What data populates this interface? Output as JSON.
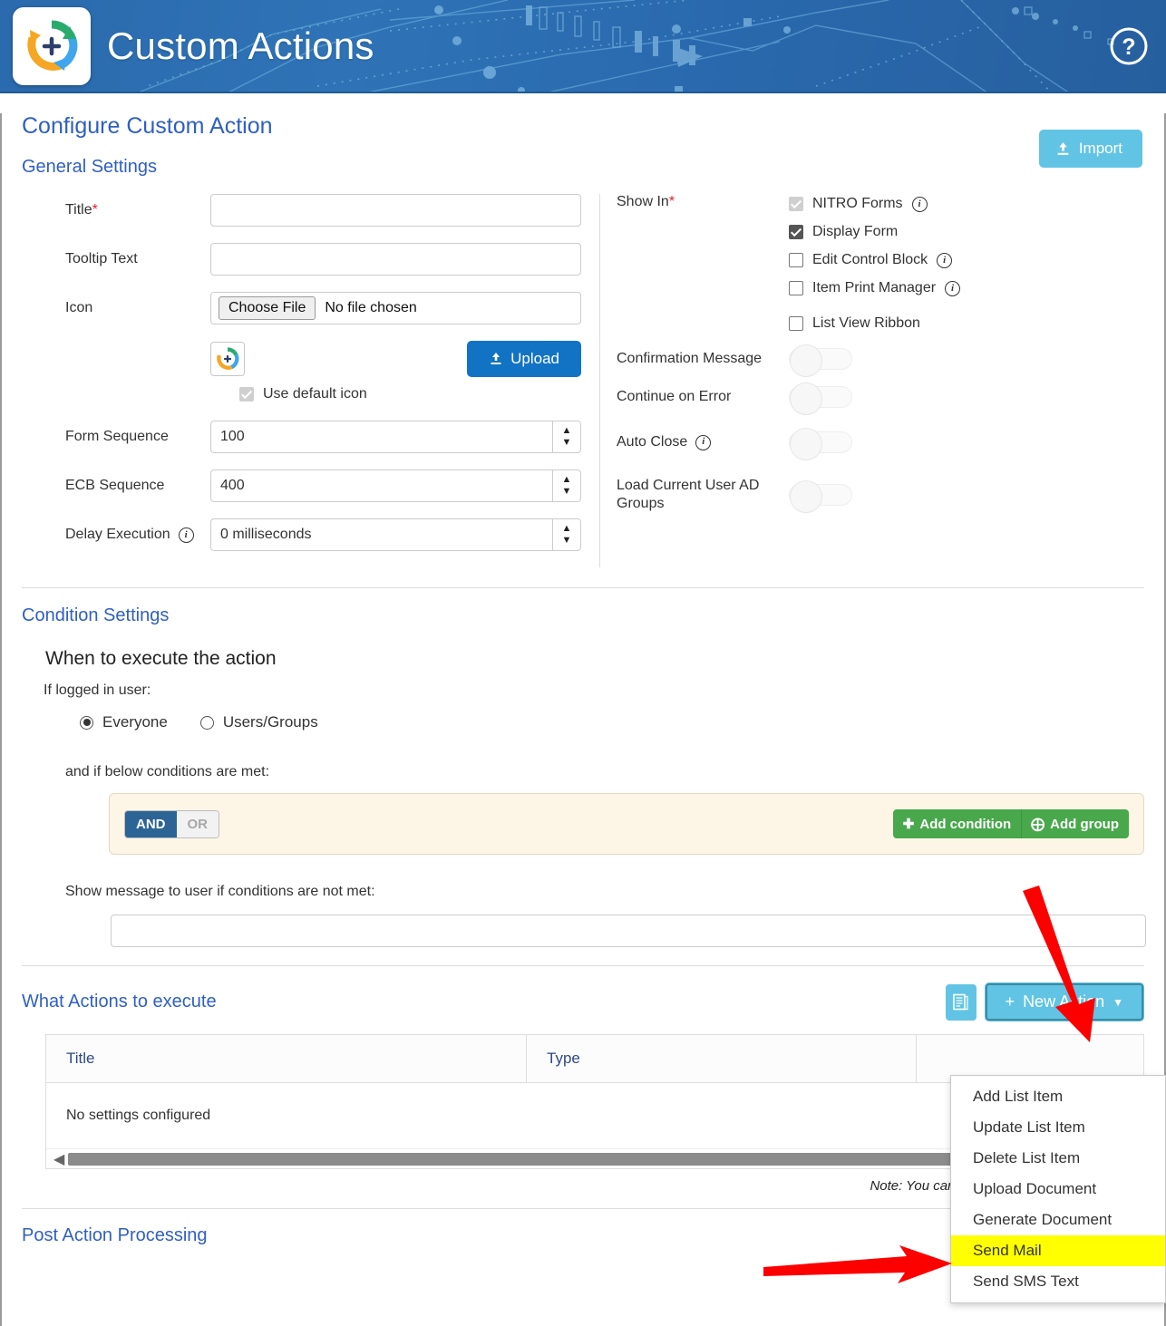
{
  "header": {
    "title": "Custom Actions",
    "logo_icon": "refresh-plus-logo",
    "help_icon": "question-circle-icon"
  },
  "page": {
    "title": "Configure Custom Action",
    "import_label": "Import",
    "import_icon": "upload-icon"
  },
  "general_settings": {
    "title": "General Settings",
    "fields": {
      "title_label": "Title",
      "title_value": "",
      "tooltip_label": "Tooltip Text",
      "tooltip_value": "",
      "icon_label": "Icon",
      "choose_file_label": "Choose File",
      "file_status": "No file chosen",
      "upload_label": "Upload",
      "use_default_icon_label": "Use default icon",
      "form_sequence_label": "Form Sequence",
      "form_sequence_value": "100",
      "ecb_sequence_label": "ECB Sequence",
      "ecb_sequence_value": "400",
      "delay_execution_label": "Delay Execution",
      "delay_execution_value": "0 milliseconds"
    },
    "show_in": {
      "label": "Show In",
      "options": [
        {
          "label": "NITRO Forms",
          "checked": true,
          "disabled": true,
          "info": true
        },
        {
          "label": "Display Form",
          "checked": true,
          "disabled": false,
          "info": false
        },
        {
          "label": "Edit Control Block",
          "checked": false,
          "disabled": false,
          "info": true
        },
        {
          "label": "Item Print Manager",
          "checked": false,
          "disabled": false,
          "info": true
        },
        {
          "label": "List View Ribbon",
          "checked": false,
          "disabled": false,
          "info": false
        }
      ]
    },
    "toggles": [
      {
        "label": "Confirmation Message",
        "on": false,
        "info": false
      },
      {
        "label": "Continue on Error",
        "on": false,
        "info": false
      },
      {
        "label": "Auto Close",
        "on": false,
        "info": true
      },
      {
        "label": "Load Current User AD Groups",
        "on": false,
        "info": false
      }
    ]
  },
  "condition_settings": {
    "title": "Condition Settings",
    "when_heading": "When to execute the action",
    "if_logged_label": "If logged in user:",
    "radio_everyone": "Everyone",
    "radio_users_groups": "Users/Groups",
    "radio_selected": "Everyone",
    "conditions_label": "and if below conditions are met:",
    "operator_and": "AND",
    "operator_or": "OR",
    "operator_selected": "AND",
    "add_condition_label": "Add condition",
    "add_group_label": "Add group",
    "message_label": "Show message to user if conditions are not met:",
    "message_value": ""
  },
  "what_actions": {
    "title": "What Actions to execute",
    "grid_icon": "grid-view-icon",
    "new_action_label": "New Action",
    "new_action_icon": "plus-icon",
    "new_action_caret": "chevron-down-icon",
    "columns": [
      "Title",
      "Type"
    ],
    "empty_message": "No settings configured",
    "note": "Note: You can drag-drop actions in the gri",
    "menu_items": [
      {
        "label": "Add List Item",
        "highlighted": false
      },
      {
        "label": "Update List Item",
        "highlighted": false
      },
      {
        "label": "Delete List Item",
        "highlighted": false
      },
      {
        "label": "Upload Document",
        "highlighted": false
      },
      {
        "label": "Generate Document",
        "highlighted": false
      },
      {
        "label": "Send Mail",
        "highlighted": true
      },
      {
        "label": "Send SMS Text",
        "highlighted": false
      }
    ]
  },
  "post_action": {
    "title": "Post Action Processing"
  },
  "colors": {
    "banner_blue": "#2a6aad",
    "link_blue": "#2f5fc4",
    "accent_cyan": "#62c4e4",
    "primary_blue": "#1273c4",
    "green": "#49a84c",
    "annotation_red": "#fc0000",
    "highlight_yellow": "#ffff00",
    "condition_bg": "#fdf6e7"
  }
}
